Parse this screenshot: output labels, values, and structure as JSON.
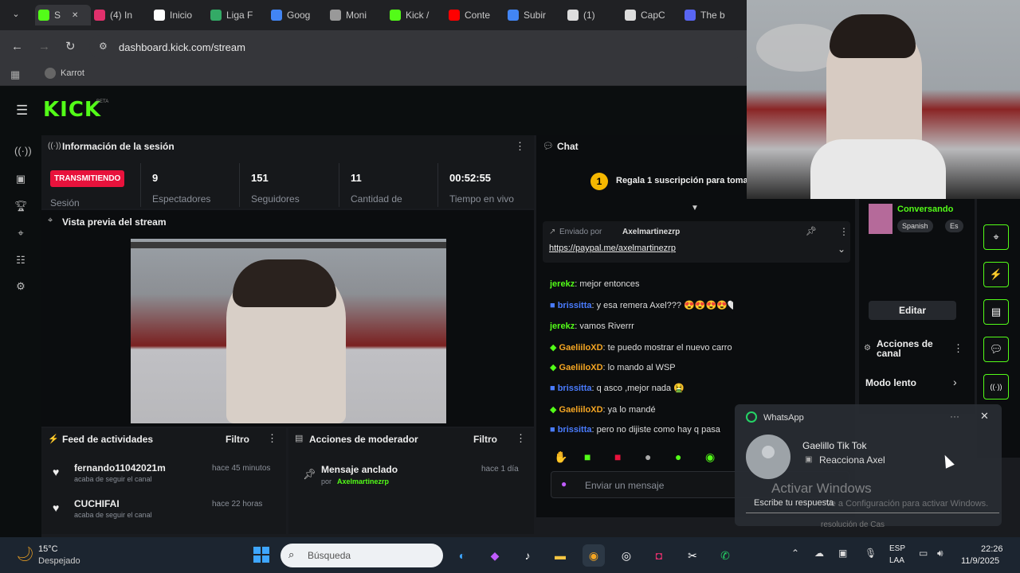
{
  "browser": {
    "tabs": [
      {
        "label": "S",
        "color": "#53fc18"
      },
      {
        "label": "(4) In",
        "color": "#e1306c"
      },
      {
        "label": "Inicio",
        "color": "#ffffff"
      },
      {
        "label": "Liga F",
        "color": "#3a6"
      },
      {
        "label": "Goog",
        "color": "#4285f4"
      },
      {
        "label": "Moni",
        "color": "#999"
      },
      {
        "label": "Kick /",
        "color": "#53fc18"
      },
      {
        "label": "Conte",
        "color": "#ff0000"
      },
      {
        "label": "Subir",
        "color": "#4285f4"
      },
      {
        "label": "(1)",
        "color": "#ddd"
      },
      {
        "label": "CapC",
        "color": "#ddd"
      },
      {
        "label": "The b",
        "color": "#5865f2"
      }
    ],
    "url": "dashboard.kick.com/stream",
    "bookmark": "Karrot"
  },
  "kick": {
    "logo": "KICK",
    "logo_tag": "BETA",
    "session": {
      "title": "Información de la sesión",
      "status": "TRANSMITIENDO",
      "status_sub": "Sesión",
      "stats": [
        {
          "value": "9",
          "label": "Espectadores"
        },
        {
          "value": "151",
          "label": "Seguidores"
        },
        {
          "value": "11",
          "label": "Cantidad de"
        },
        {
          "value": "00:52:55",
          "label": "Tiempo en vivo"
        }
      ]
    },
    "preview_title": "Vista previa del stream",
    "feed": {
      "title": "Feed de actividades",
      "filter": "Filtro",
      "items": [
        {
          "user": "fernando11042021m",
          "action": "acaba de seguir el canal",
          "time": "hace 45 minutos"
        },
        {
          "user": "CUCHIFAI",
          "action": "acaba de seguir el canal",
          "time": "hace 22 horas"
        }
      ]
    },
    "modactions": {
      "title": "Acciones de moderador",
      "filter": "Filtro",
      "item_title": "Mensaje anclado",
      "item_by": "por",
      "item_user": "Axelmartinezrp",
      "item_time": "hace 1 día"
    },
    "chat": {
      "title": "Chat",
      "sub_banner": "Regala 1 suscripción para toma",
      "pinned_by_label": "Enviado por",
      "pinned_user": "Axelmartinezrp",
      "pinned_link": "https://paypal.me/axelmartinezrp",
      "messages": [
        {
          "user": "jerekz",
          "text": ": mejor entonces",
          "color": "#53fc18"
        },
        {
          "user": "brissitta",
          "text": ": y esa remera Axel??? 😍😍😍😍🤍❤️🤍",
          "color": "#4a7cff"
        },
        {
          "user": "jerekz",
          "text": ": vamos Riverrr",
          "color": "#53fc18"
        },
        {
          "user": "GaeliiloXD",
          "text": ": te puedo mostrar el nuevo carro que me compré?",
          "color": "#f5a623"
        },
        {
          "user": "GaeliiloXD",
          "text": ": lo mando al WSP",
          "color": "#f5a623"
        },
        {
          "user": "brissitta",
          "text": ": q asco ,mejor nada 🤮",
          "color": "#4a7cff"
        },
        {
          "user": "GaeliiloXD",
          "text": ": ya lo mandé",
          "color": "#f5a623"
        },
        {
          "user": "brissitta",
          "text": ": pero no dijiste como hay q pasa",
          "color": "#4a7cff"
        }
      ],
      "input_placeholder": "Enviar un mensaje"
    },
    "right": {
      "status": "Conversando",
      "lang1": "Spanish",
      "lang2": "Es",
      "edit": "Editar",
      "channel_actions": "Acciones de canal",
      "slow_mode": "Modo lento"
    }
  },
  "whatsapp": {
    "app": "WhatsApp",
    "sender": "Gaelillo Tik Tok",
    "message": "Reacciona Axel",
    "reply": "Escribe tu respuesta",
    "activate_title": "Activar Windows",
    "activate_sub": "Ve a Configuración para activar Windows.",
    "cut_text": "resolución de Cas"
  },
  "taskbar": {
    "temp": "15°C",
    "weather": "Despejado",
    "search": "Búsqueda",
    "lang1": "ESP",
    "lang2": "LAA",
    "time": "22:26",
    "date": "11/9/2025"
  }
}
